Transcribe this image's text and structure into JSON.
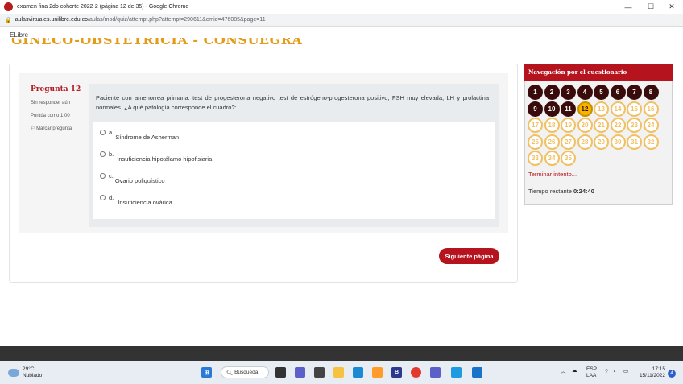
{
  "browser": {
    "tab_title": "examen fina 2do cohorte 2022-2 (página 12 de 35) - Google Chrome",
    "url_host": "aulasvirtuales.unilibre.edu.co",
    "url_path": "/aulas/mod/quiz/attempt.php?attempt=290611&cmid=476085&page=11",
    "minimize": "—",
    "maximize": "☐",
    "close": "✕"
  },
  "site": {
    "brand": "ELibre",
    "course_title": "GINECO-OBSTETRICIA - CONSUEGRA"
  },
  "question": {
    "number_label": "Pregunta",
    "number": "12",
    "state": "Sin responder aún",
    "grade": "Puntúa como 1,00",
    "flag": "Marcar pregunta",
    "text": "Paciente con amenorrea primaria: test de progesterona negativo test de estrógeno-progesterona positivo, FSH muy elevada, LH y prolactina normales. ¿A qué patología corresponde el cuadro?:",
    "options": [
      {
        "letter": "a.",
        "text": "Síndrome de Asherman"
      },
      {
        "letter": "b.",
        "text": "Insuficiencia hipotálamo hipofisiaria"
      },
      {
        "letter": "c.",
        "text": "Ovario poliquístico"
      },
      {
        "letter": "d.",
        "text": "Insuficiencia ovárica"
      }
    ],
    "next_button": "Siguiente página"
  },
  "nav": {
    "title": "Navegación por el cuestionario",
    "buttons": [
      "1",
      "2",
      "3",
      "4",
      "5",
      "6",
      "7",
      "8",
      "9",
      "10",
      "11",
      "12",
      "13",
      "14",
      "15",
      "16",
      "17",
      "18",
      "19",
      "20",
      "21",
      "22",
      "23",
      "24",
      "25",
      "26",
      "27",
      "28",
      "29",
      "30",
      "31",
      "32",
      "33",
      "34",
      "35"
    ],
    "answered_count": 11,
    "current": "12",
    "finish_link": "Terminar intento...",
    "time_label": "Tiempo restante",
    "time_value": "0:24:40"
  },
  "taskbar": {
    "temperature": "29°C",
    "condition": "Nublado",
    "search": "Búsqueda",
    "lang_top": "ESP",
    "lang_bottom": "LAA",
    "time": "17:15",
    "date": "15/11/2022",
    "notifications": "4"
  },
  "colors": {
    "accent_red": "#b5141e",
    "answered": "#3a0b0b",
    "current": "#f4b400",
    "course_title": "#e39b18"
  }
}
